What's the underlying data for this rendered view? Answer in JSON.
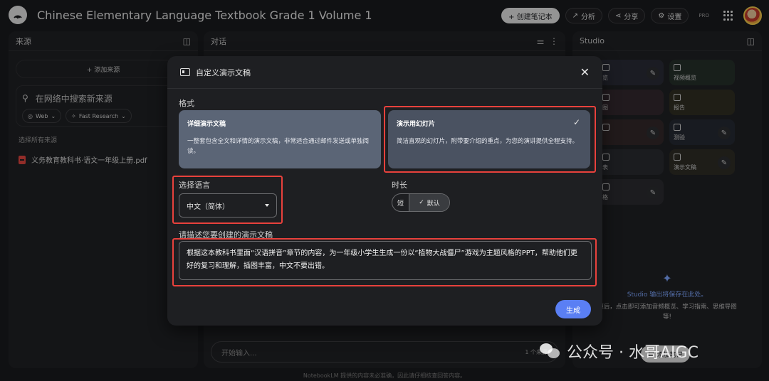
{
  "app": {
    "notebook_title": "Chinese Elementary Language Textbook Grade 1 Volume 1",
    "create_notebook": "+ 创建笔记本",
    "analyze": "分析",
    "share": "分享",
    "settings": "设置",
    "pro": "PRO"
  },
  "sources": {
    "header": "来源",
    "add_source": "+ 添加来源",
    "search_placeholder": "在网络中搜索新来源",
    "chip_web": "Web",
    "chip_research": "Fast Research",
    "select_all": "选择所有来源",
    "items": [
      "义务教育教科书·语文一年级上册.pdf"
    ]
  },
  "chat": {
    "header": "对话",
    "input_placeholder": "开始输入...",
    "source_count": "1 个来源"
  },
  "studio": {
    "header": "Studio",
    "cards": [
      {
        "label": "览"
      },
      {
        "label": "视频概览"
      },
      {
        "label": "图"
      },
      {
        "label": "报告"
      },
      {
        "label": ""
      },
      {
        "label": "测验"
      },
      {
        "label": "表"
      },
      {
        "label": "演示文稿"
      },
      {
        "label": "格"
      }
    ],
    "hint_title": "Studio 输出将保存在此处。",
    "hint_body_1": "源后，点击即可添加音频概览、学习指南、思维导图",
    "hint_body_2": "等!",
    "add_note": "添加笔记"
  },
  "footer": "NotebookLM 提供的内容未必准确，因此请仔细核查回答内容。",
  "modal": {
    "title": "自定义演示文稿",
    "format_label": "格式",
    "detail_title": "详细演示文稿",
    "detail_desc": "一整套包含全文和详情的演示文稿，非常适合通过邮件发送或单独阅读。",
    "slides_title": "演示用幻灯片",
    "slides_desc": "简洁直观的幻灯片，附带要介绍的重点，为您的演讲提供全程支持。",
    "language_label": "选择语言",
    "language_value": "中文（简体）",
    "duration_label": "时长",
    "duration_short": "短",
    "duration_default": "默认",
    "prompt_label": "请描述您要创建的演示文稿",
    "prompt_value": "根据这本教科书里面“汉语拼音”章节的内容，为一年级小学生生成一份以“植物大战僵尸”游戏为主题风格的PPT，帮助他们更好的复习和理解，插图丰富，中文不要出错。",
    "generate": "生成"
  },
  "watermark": "公众号 · 水哥AIGC",
  "colors": {
    "accent_blue": "#5a7ff4",
    "highlight_red": "#e8413c",
    "background": "#1a1b1e"
  }
}
